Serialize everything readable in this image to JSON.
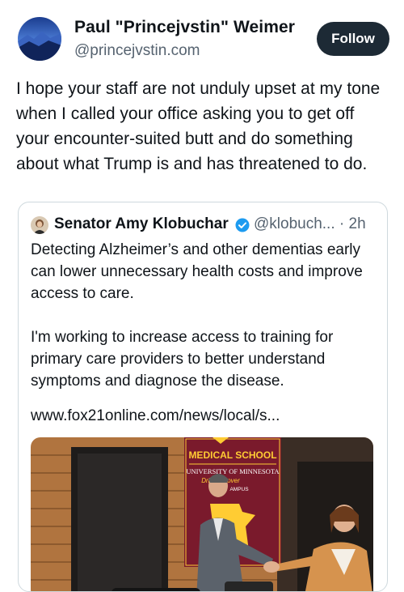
{
  "post": {
    "author_name": "Paul \"Princejvstin\" Weimer",
    "author_handle": "@princejvstin.com",
    "follow_label": "Follow",
    "text": "I hope your staff are not unduly upset at my tone when I called your office asking you to get off your encounter-suited butt and do something about what Trump is and has threatened to do."
  },
  "quote": {
    "author_name": "Senator Amy Klobuchar",
    "handle_time": "@klobuch... · 2h",
    "paragraphs": [
      "Detecting Alzheimer’s and other dementias early can lower unnecessary health costs and improve access to care.",
      "I'm working to increase access to training for primary care providers to better understand symptoms and diagnose the disease."
    ],
    "link": "www.fox21online.com/news/local/s...",
    "media": {
      "banner_title": "MEDICAL SCHOOL",
      "banner_line1": "UNIVERSITY OF MINNESOTA",
      "banner_line2": "Driv     Discover",
      "banner_line3": "AMPUS"
    }
  },
  "colors": {
    "follow_bg": "#1d2a35",
    "verified": "#1d9bf0",
    "banner": "#7a1a2c",
    "banner_text": "#ffcc33"
  },
  "icons": [
    "verified-badge-icon"
  ]
}
